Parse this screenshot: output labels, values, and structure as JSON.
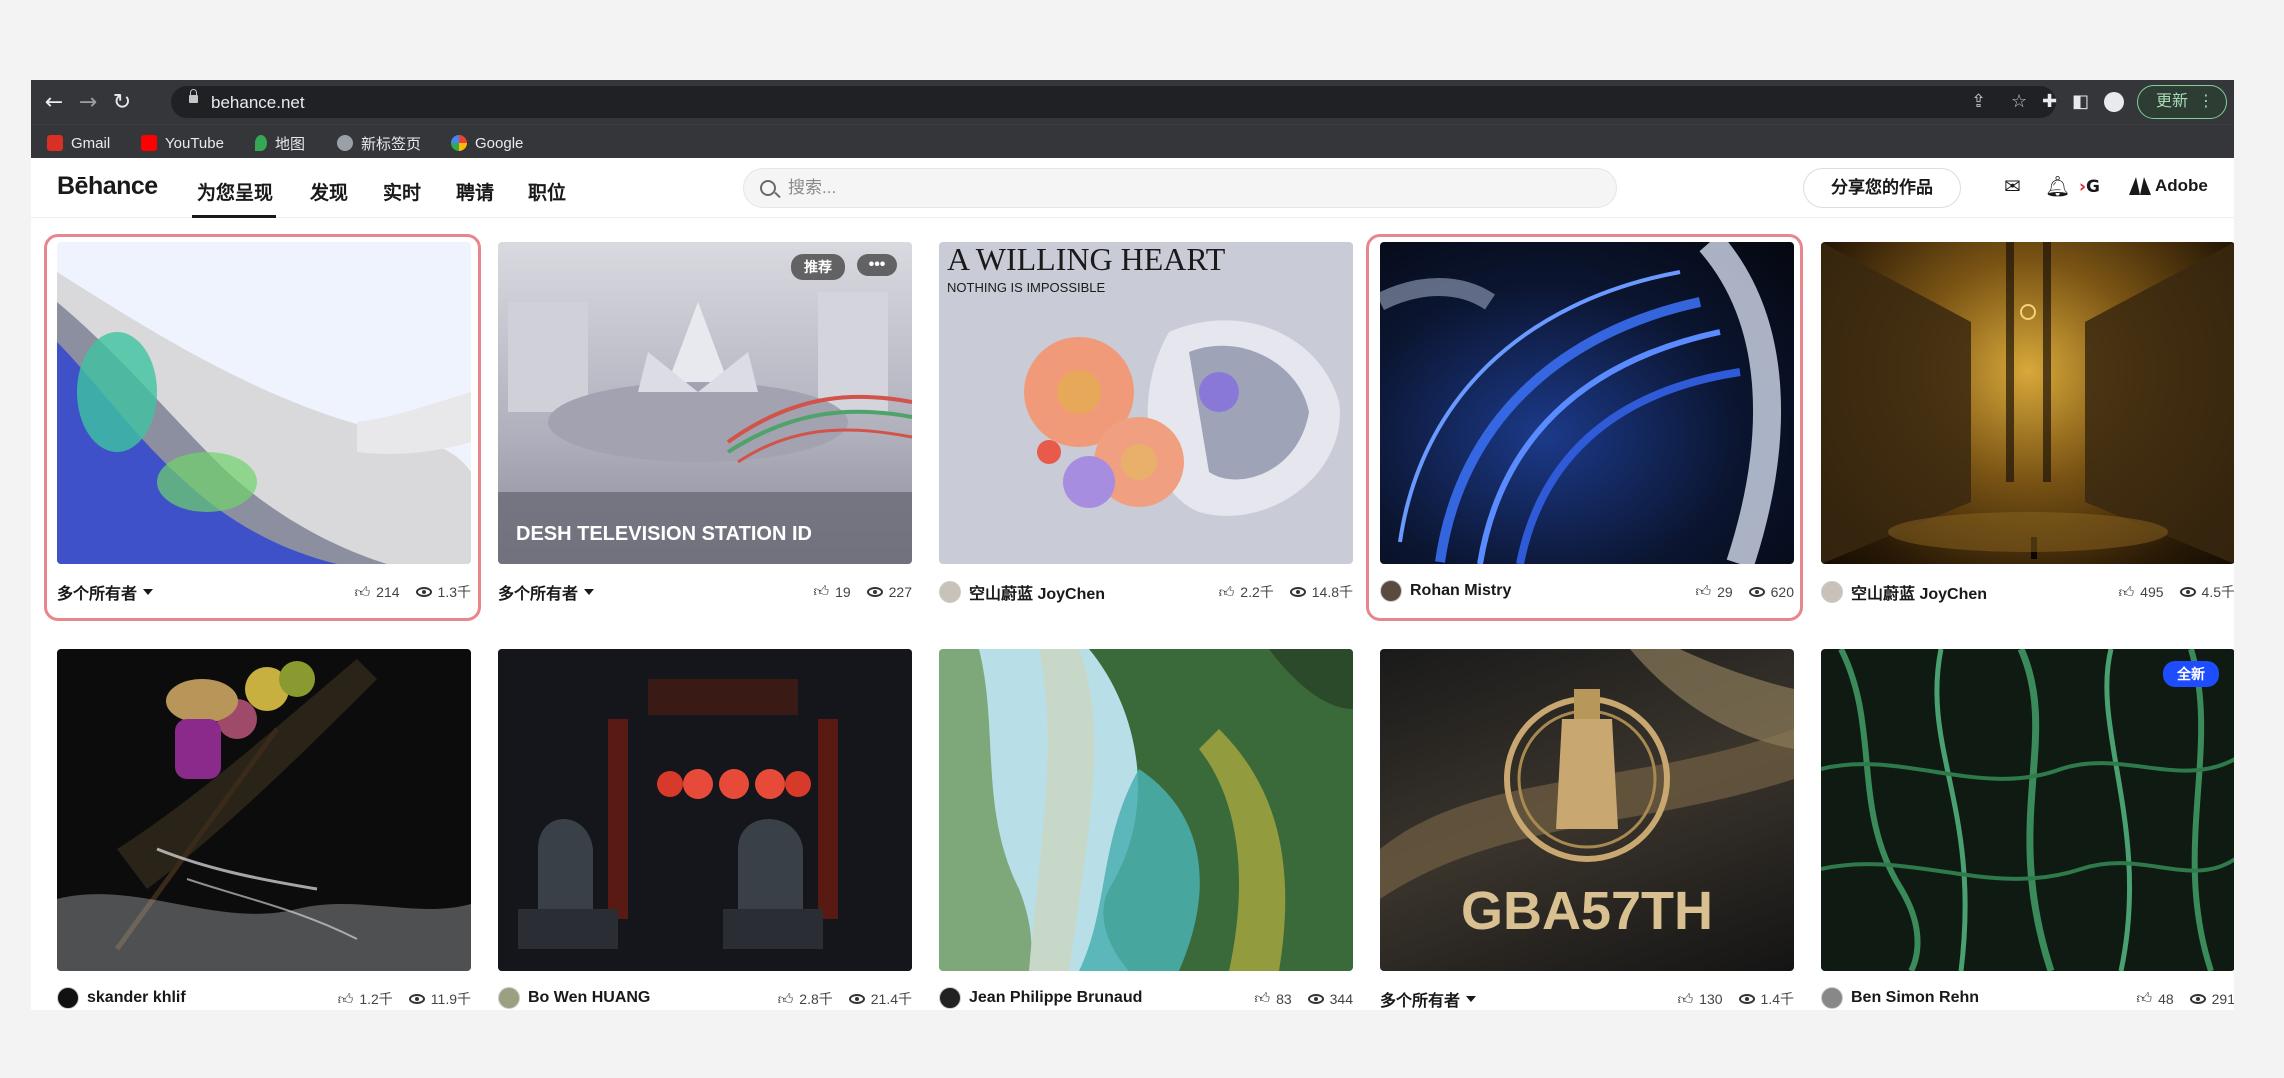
{
  "browser": {
    "url": "behance.net",
    "update_label": "更新",
    "bookmarks": [
      {
        "label": "Gmail",
        "color": "#d93025"
      },
      {
        "label": "YouTube",
        "color": "#ff0000"
      },
      {
        "label": "地图",
        "color": "#34a853"
      },
      {
        "label": "新标签页",
        "color": "#9aa0a6"
      },
      {
        "label": "Google",
        "color": "#4285f4"
      }
    ]
  },
  "site": {
    "logo": "Bēhance",
    "nav": [
      "为您呈现",
      "发现",
      "实时",
      "聘请",
      "职位"
    ],
    "search_placeholder": "搜索...",
    "share_label": "分享您的作品",
    "adobe_label": "Adobe",
    "brand_color": "#0057ff"
  },
  "projects": [
    {
      "owner": "多个所有者",
      "multi": true,
      "likes": "214",
      "views": "1.3千",
      "highlighted": true,
      "title": "",
      "tag": ""
    },
    {
      "owner": "多个所有者",
      "multi": true,
      "likes": "19",
      "views": "227",
      "highlighted": false,
      "title": "DESH TELEVISION STATION ID",
      "tag": "推荐"
    },
    {
      "owner": "空山蔚蓝 JoyChen",
      "multi": false,
      "likes": "2.2千",
      "views": "14.8千",
      "highlighted": false,
      "title": "",
      "tag": ""
    },
    {
      "owner": "Rohan Mistry",
      "multi": false,
      "likes": "29",
      "views": "620",
      "highlighted": true,
      "title": "",
      "tag": ""
    },
    {
      "owner": "空山蔚蓝 JoyChen",
      "multi": false,
      "likes": "495",
      "views": "4.5千",
      "highlighted": false,
      "title": "",
      "tag": ""
    },
    {
      "owner": "skander khlif",
      "multi": false,
      "likes": "1.2千",
      "views": "11.9千",
      "highlighted": false,
      "title": "",
      "tag": ""
    },
    {
      "owner": "Bo Wen HUANG",
      "multi": false,
      "likes": "2.8千",
      "views": "21.4千",
      "highlighted": false,
      "title": "",
      "tag": ""
    },
    {
      "owner": "Jean Philippe Brunaud",
      "multi": false,
      "likes": "83",
      "views": "344",
      "highlighted": false,
      "title": "",
      "tag": ""
    },
    {
      "owner": "多个所有者",
      "multi": true,
      "likes": "130",
      "views": "1.4千",
      "highlighted": false,
      "title": "",
      "tag": ""
    },
    {
      "owner": "Ben Simon Rehn",
      "multi": false,
      "likes": "48",
      "views": "291",
      "highlighted": false,
      "title": "",
      "tag": "全新"
    }
  ],
  "thumb_art": [
    "A WILLING HEART",
    "NOTHING IS IMPOSSIBLE",
    "GBA57TH"
  ]
}
